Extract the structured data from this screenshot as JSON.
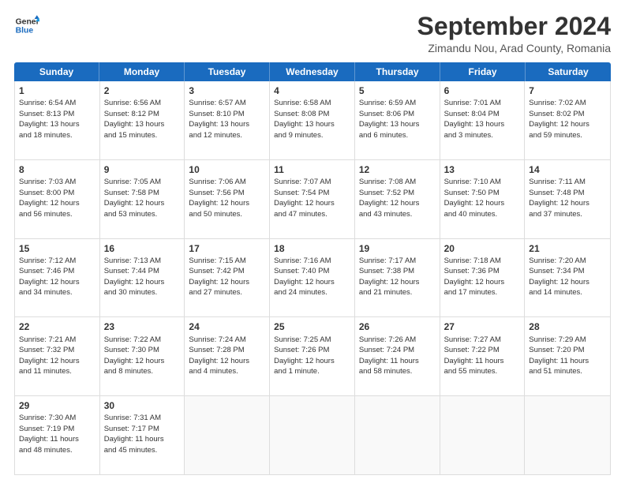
{
  "logo": {
    "line1": "General",
    "line2": "Blue"
  },
  "title": "September 2024",
  "location": "Zimandu Nou, Arad County, Romania",
  "header_days": [
    "Sunday",
    "Monday",
    "Tuesday",
    "Wednesday",
    "Thursday",
    "Friday",
    "Saturday"
  ],
  "weeks": [
    [
      {
        "day": "1",
        "text": "Sunrise: 6:54 AM\nSunset: 8:13 PM\nDaylight: 13 hours\nand 18 minutes."
      },
      {
        "day": "2",
        "text": "Sunrise: 6:56 AM\nSunset: 8:12 PM\nDaylight: 13 hours\nand 15 minutes."
      },
      {
        "day": "3",
        "text": "Sunrise: 6:57 AM\nSunset: 8:10 PM\nDaylight: 13 hours\nand 12 minutes."
      },
      {
        "day": "4",
        "text": "Sunrise: 6:58 AM\nSunset: 8:08 PM\nDaylight: 13 hours\nand 9 minutes."
      },
      {
        "day": "5",
        "text": "Sunrise: 6:59 AM\nSunset: 8:06 PM\nDaylight: 13 hours\nand 6 minutes."
      },
      {
        "day": "6",
        "text": "Sunrise: 7:01 AM\nSunset: 8:04 PM\nDaylight: 13 hours\nand 3 minutes."
      },
      {
        "day": "7",
        "text": "Sunrise: 7:02 AM\nSunset: 8:02 PM\nDaylight: 12 hours\nand 59 minutes."
      }
    ],
    [
      {
        "day": "8",
        "text": "Sunrise: 7:03 AM\nSunset: 8:00 PM\nDaylight: 12 hours\nand 56 minutes."
      },
      {
        "day": "9",
        "text": "Sunrise: 7:05 AM\nSunset: 7:58 PM\nDaylight: 12 hours\nand 53 minutes."
      },
      {
        "day": "10",
        "text": "Sunrise: 7:06 AM\nSunset: 7:56 PM\nDaylight: 12 hours\nand 50 minutes."
      },
      {
        "day": "11",
        "text": "Sunrise: 7:07 AM\nSunset: 7:54 PM\nDaylight: 12 hours\nand 47 minutes."
      },
      {
        "day": "12",
        "text": "Sunrise: 7:08 AM\nSunset: 7:52 PM\nDaylight: 12 hours\nand 43 minutes."
      },
      {
        "day": "13",
        "text": "Sunrise: 7:10 AM\nSunset: 7:50 PM\nDaylight: 12 hours\nand 40 minutes."
      },
      {
        "day": "14",
        "text": "Sunrise: 7:11 AM\nSunset: 7:48 PM\nDaylight: 12 hours\nand 37 minutes."
      }
    ],
    [
      {
        "day": "15",
        "text": "Sunrise: 7:12 AM\nSunset: 7:46 PM\nDaylight: 12 hours\nand 34 minutes."
      },
      {
        "day": "16",
        "text": "Sunrise: 7:13 AM\nSunset: 7:44 PM\nDaylight: 12 hours\nand 30 minutes."
      },
      {
        "day": "17",
        "text": "Sunrise: 7:15 AM\nSunset: 7:42 PM\nDaylight: 12 hours\nand 27 minutes."
      },
      {
        "day": "18",
        "text": "Sunrise: 7:16 AM\nSunset: 7:40 PM\nDaylight: 12 hours\nand 24 minutes."
      },
      {
        "day": "19",
        "text": "Sunrise: 7:17 AM\nSunset: 7:38 PM\nDaylight: 12 hours\nand 21 minutes."
      },
      {
        "day": "20",
        "text": "Sunrise: 7:18 AM\nSunset: 7:36 PM\nDaylight: 12 hours\nand 17 minutes."
      },
      {
        "day": "21",
        "text": "Sunrise: 7:20 AM\nSunset: 7:34 PM\nDaylight: 12 hours\nand 14 minutes."
      }
    ],
    [
      {
        "day": "22",
        "text": "Sunrise: 7:21 AM\nSunset: 7:32 PM\nDaylight: 12 hours\nand 11 minutes."
      },
      {
        "day": "23",
        "text": "Sunrise: 7:22 AM\nSunset: 7:30 PM\nDaylight: 12 hours\nand 8 minutes."
      },
      {
        "day": "24",
        "text": "Sunrise: 7:24 AM\nSunset: 7:28 PM\nDaylight: 12 hours\nand 4 minutes."
      },
      {
        "day": "25",
        "text": "Sunrise: 7:25 AM\nSunset: 7:26 PM\nDaylight: 12 hours\nand 1 minute."
      },
      {
        "day": "26",
        "text": "Sunrise: 7:26 AM\nSunset: 7:24 PM\nDaylight: 11 hours\nand 58 minutes."
      },
      {
        "day": "27",
        "text": "Sunrise: 7:27 AM\nSunset: 7:22 PM\nDaylight: 11 hours\nand 55 minutes."
      },
      {
        "day": "28",
        "text": "Sunrise: 7:29 AM\nSunset: 7:20 PM\nDaylight: 11 hours\nand 51 minutes."
      }
    ],
    [
      {
        "day": "29",
        "text": "Sunrise: 7:30 AM\nSunset: 7:19 PM\nDaylight: 11 hours\nand 48 minutes."
      },
      {
        "day": "30",
        "text": "Sunrise: 7:31 AM\nSunset: 7:17 PM\nDaylight: 11 hours\nand 45 minutes."
      },
      {
        "day": "",
        "text": ""
      },
      {
        "day": "",
        "text": ""
      },
      {
        "day": "",
        "text": ""
      },
      {
        "day": "",
        "text": ""
      },
      {
        "day": "",
        "text": ""
      }
    ]
  ]
}
